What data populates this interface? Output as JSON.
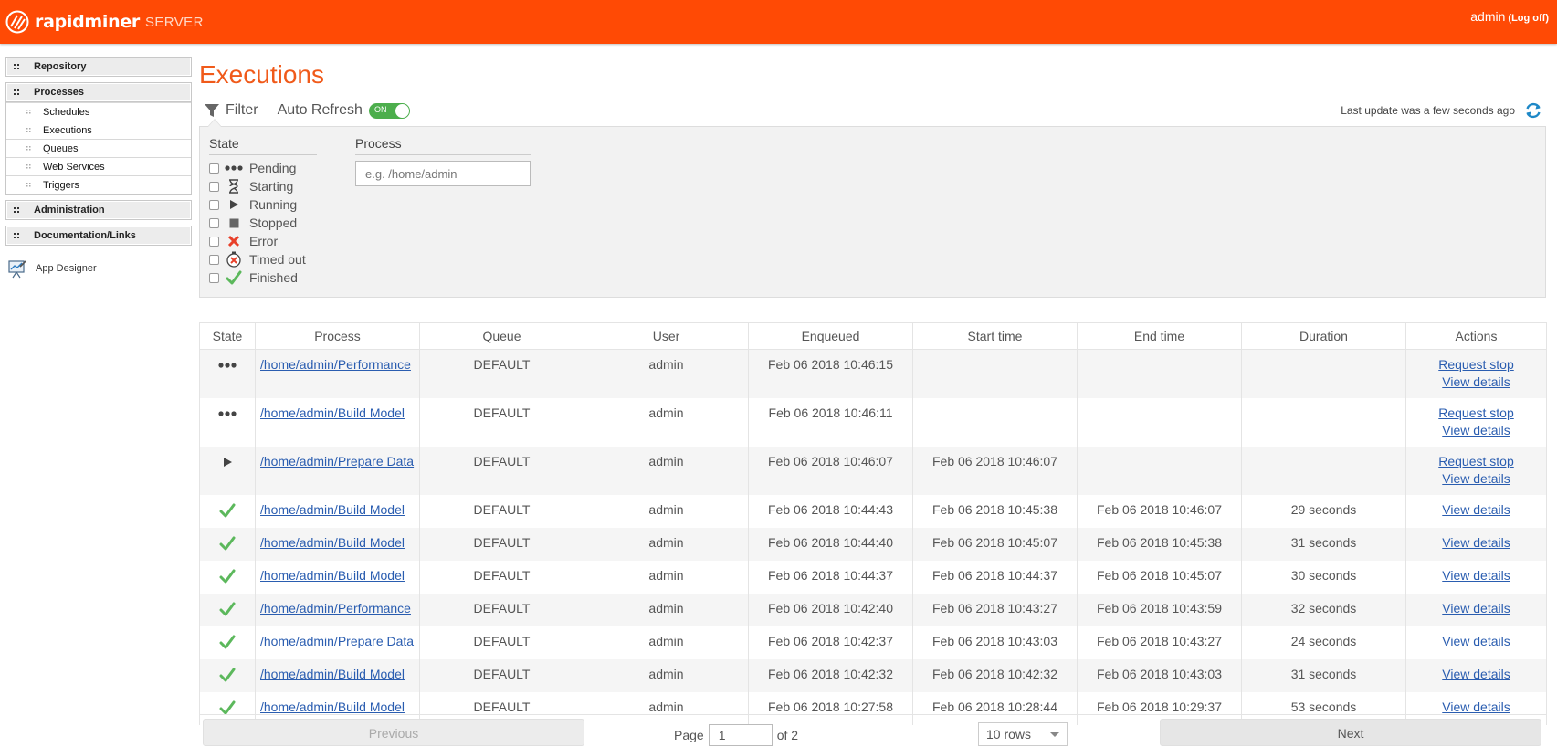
{
  "header": {
    "brand": "rapidminer",
    "product": "SERVER",
    "user": "admin",
    "logoff": "(Log off)"
  },
  "sidebar": {
    "sections": [
      {
        "label": "Repository"
      },
      {
        "label": "Processes",
        "items": [
          "Schedules",
          "Executions",
          "Queues",
          "Web Services",
          "Triggers"
        ]
      },
      {
        "label": "Administration"
      },
      {
        "label": "Documentation/Links"
      }
    ],
    "app_designer": "App Designer"
  },
  "page": {
    "title": "Executions",
    "filter_label": "Filter",
    "auto_refresh_label": "Auto Refresh",
    "toggle_state": "ON",
    "last_update": "Last update was a few seconds ago"
  },
  "filter": {
    "state_label": "State",
    "process_label": "Process",
    "process_placeholder": "e.g. /home/admin",
    "states": [
      {
        "label": "Pending",
        "icon": "pending-icon"
      },
      {
        "label": "Starting",
        "icon": "hourglass-icon"
      },
      {
        "label": "Running",
        "icon": "play-icon"
      },
      {
        "label": "Stopped",
        "icon": "stop-icon"
      },
      {
        "label": "Error",
        "icon": "error-x-icon"
      },
      {
        "label": "Timed out",
        "icon": "timeout-icon"
      },
      {
        "label": "Finished",
        "icon": "checkmark-icon"
      }
    ]
  },
  "table": {
    "columns": [
      "State",
      "Process",
      "Queue",
      "User",
      "Enqueued",
      "Start time",
      "End time",
      "Duration",
      "Actions"
    ],
    "rows": [
      {
        "state": "pending",
        "process": "/home/admin/Performance",
        "queue": "DEFAULT",
        "user": "admin",
        "enqueued": "Feb 06 2018 10:46:15",
        "start": "",
        "end": "",
        "duration": "",
        "actions": [
          "Request stop",
          "View details"
        ]
      },
      {
        "state": "pending",
        "process": "/home/admin/Build Model",
        "queue": "DEFAULT",
        "user": "admin",
        "enqueued": "Feb 06 2018 10:46:11",
        "start": "",
        "end": "",
        "duration": "",
        "actions": [
          "Request stop",
          "View details"
        ]
      },
      {
        "state": "running",
        "process": "/home/admin/Prepare Data",
        "queue": "DEFAULT",
        "user": "admin",
        "enqueued": "Feb 06 2018 10:46:07",
        "start": "Feb 06 2018 10:46:07",
        "end": "",
        "duration": "",
        "actions": [
          "Request stop",
          "View details"
        ]
      },
      {
        "state": "finished",
        "process": "/home/admin/Build Model",
        "queue": "DEFAULT",
        "user": "admin",
        "enqueued": "Feb 06 2018 10:44:43",
        "start": "Feb 06 2018 10:45:38",
        "end": "Feb 06 2018 10:46:07",
        "duration": "29 seconds",
        "actions": [
          "View details"
        ]
      },
      {
        "state": "finished",
        "process": "/home/admin/Build Model",
        "queue": "DEFAULT",
        "user": "admin",
        "enqueued": "Feb 06 2018 10:44:40",
        "start": "Feb 06 2018 10:45:07",
        "end": "Feb 06 2018 10:45:38",
        "duration": "31 seconds",
        "actions": [
          "View details"
        ]
      },
      {
        "state": "finished",
        "process": "/home/admin/Build Model",
        "queue": "DEFAULT",
        "user": "admin",
        "enqueued": "Feb 06 2018 10:44:37",
        "start": "Feb 06 2018 10:44:37",
        "end": "Feb 06 2018 10:45:07",
        "duration": "30 seconds",
        "actions": [
          "View details"
        ]
      },
      {
        "state": "finished",
        "process": "/home/admin/Performance",
        "queue": "DEFAULT",
        "user": "admin",
        "enqueued": "Feb 06 2018 10:42:40",
        "start": "Feb 06 2018 10:43:27",
        "end": "Feb 06 2018 10:43:59",
        "duration": "32 seconds",
        "actions": [
          "View details"
        ]
      },
      {
        "state": "finished",
        "process": "/home/admin/Prepare Data",
        "queue": "DEFAULT",
        "user": "admin",
        "enqueued": "Feb 06 2018 10:42:37",
        "start": "Feb 06 2018 10:43:03",
        "end": "Feb 06 2018 10:43:27",
        "duration": "24 seconds",
        "actions": [
          "View details"
        ]
      },
      {
        "state": "finished",
        "process": "/home/admin/Build Model",
        "queue": "DEFAULT",
        "user": "admin",
        "enqueued": "Feb 06 2018 10:42:32",
        "start": "Feb 06 2018 10:42:32",
        "end": "Feb 06 2018 10:43:03",
        "duration": "31 seconds",
        "actions": [
          "View details"
        ]
      },
      {
        "state": "finished",
        "process": "/home/admin/Build Model",
        "queue": "DEFAULT",
        "user": "admin",
        "enqueued": "Feb 06 2018 10:27:58",
        "start": "Feb 06 2018 10:28:44",
        "end": "Feb 06 2018 10:29:37",
        "duration": "53 seconds",
        "actions": [
          "View details"
        ]
      }
    ]
  },
  "pager": {
    "previous": "Previous",
    "page_label": "Page",
    "page_value": "1",
    "of_label": "of 2",
    "rows_option": "10 rows",
    "next": "Next"
  },
  "colors": {
    "brand": "#ff4a05",
    "title": "#f05a1a",
    "link": "#2a5db0",
    "success": "#5cb85c",
    "toggle_on": "#4cae4c",
    "error": "#e8402a",
    "refresh": "#1e88c7"
  }
}
